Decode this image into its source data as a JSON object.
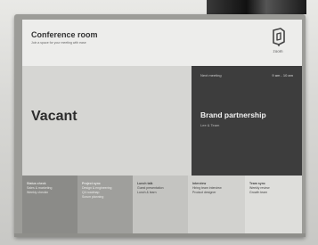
{
  "header": {
    "room_name": "Conference room",
    "room_description": "Join a space for your meeting with ease",
    "logo_text": "zoom"
  },
  "status": {
    "label": "Vacant"
  },
  "next_meeting": {
    "label": "Next meeting",
    "time": "9 am - 10 am",
    "title": "Brand partnership",
    "host": "Lee & Team"
  },
  "schedule": [
    {
      "title": "Status check",
      "lines": [
        "Sales & marketing",
        "Weekly checkin"
      ]
    },
    {
      "title": "Project sync",
      "lines": [
        "Design & engineering",
        "Q4 roadmap",
        "Scrum planning"
      ]
    },
    {
      "title": "Lunch talk",
      "lines": [
        "Guest presentation",
        "Lunch & learn"
      ]
    },
    {
      "title": "Interview",
      "lines": [
        "Hiring team interview",
        "Product designer"
      ]
    },
    {
      "title": "Team sync",
      "lines": [
        "Weekly review",
        "Growth team"
      ]
    }
  ],
  "colors": {
    "next_panel_bg": "#3d3d3d",
    "status_panel_bg": "#d6d6d3"
  }
}
